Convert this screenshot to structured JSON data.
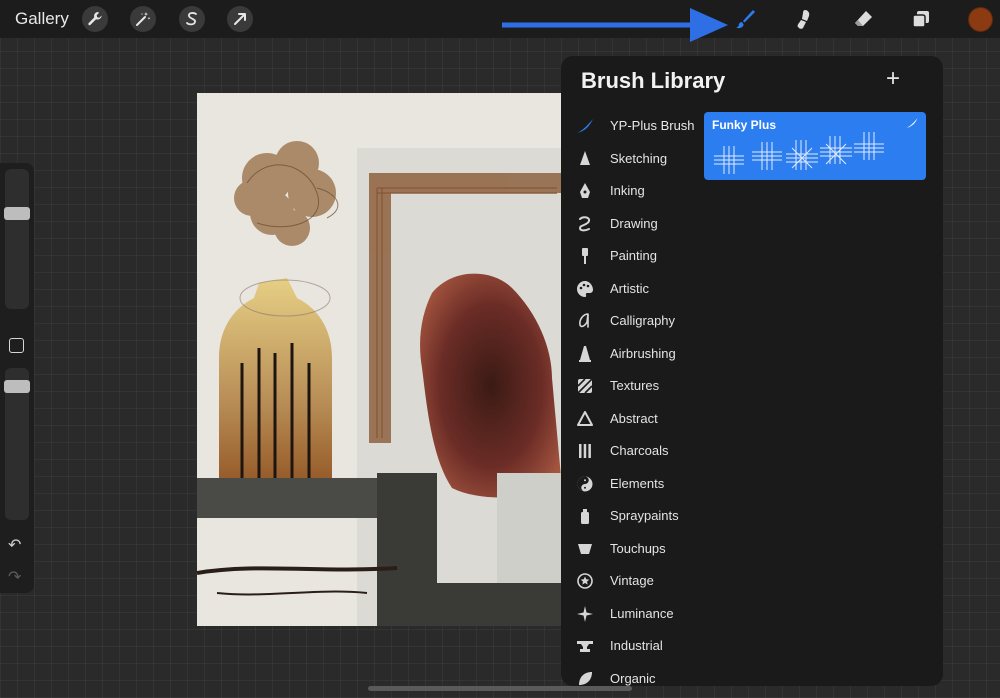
{
  "topbar": {
    "gallery_label": "Gallery",
    "tools": [
      "wrench-icon",
      "magic-wand-icon",
      "selection-icon",
      "transform-arrow-icon"
    ],
    "right_tools": [
      "brush-icon",
      "smudge-icon",
      "eraser-icon",
      "layers-icon"
    ],
    "current_color": "#8b3a12"
  },
  "accent_color": "#2c7ef0",
  "brush_library": {
    "title": "Brush Library",
    "add_label": "+",
    "categories": [
      {
        "label": "YP-Plus Brush",
        "icon": "feather-icon"
      },
      {
        "label": "Sketching",
        "icon": "pencil-tip-icon"
      },
      {
        "label": "Inking",
        "icon": "pen-nib-icon"
      },
      {
        "label": "Drawing",
        "icon": "squiggle-icon"
      },
      {
        "label": "Painting",
        "icon": "paint-brush-icon"
      },
      {
        "label": "Artistic",
        "icon": "palette-icon"
      },
      {
        "label": "Calligraphy",
        "icon": "calligraphy-icon"
      },
      {
        "label": "Airbrushing",
        "icon": "airbrush-icon"
      },
      {
        "label": "Textures",
        "icon": "texture-icon"
      },
      {
        "label": "Abstract",
        "icon": "triangle-icon"
      },
      {
        "label": "Charcoals",
        "icon": "charcoal-icon"
      },
      {
        "label": "Elements",
        "icon": "yin-yang-icon"
      },
      {
        "label": "Spraypaints",
        "icon": "spray-can-icon"
      },
      {
        "label": "Touchups",
        "icon": "bowl-icon"
      },
      {
        "label": "Vintage",
        "icon": "star-circle-icon"
      },
      {
        "label": "Luminance",
        "icon": "sparkle-icon"
      },
      {
        "label": "Industrial",
        "icon": "anvil-icon"
      },
      {
        "label": "Organic",
        "icon": "leaf-icon"
      }
    ],
    "selected_brush": {
      "name": "Funky Plus"
    }
  }
}
